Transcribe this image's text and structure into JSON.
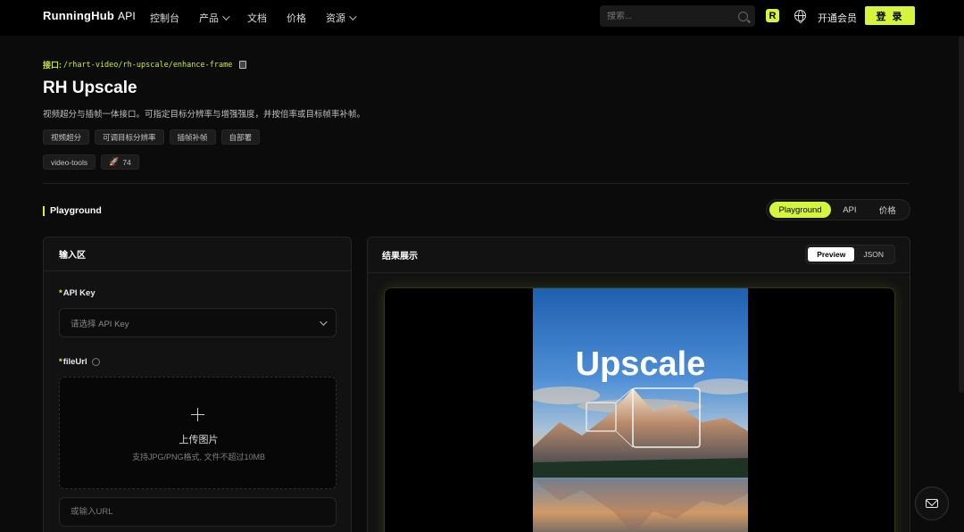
{
  "brand": {
    "name": "RunningHub",
    "suffix": "API"
  },
  "nav": {
    "items": [
      {
        "label": "控制台",
        "has_menu": false
      },
      {
        "label": "产品",
        "has_menu": true
      },
      {
        "label": "文档",
        "has_menu": false
      },
      {
        "label": "价格",
        "has_menu": false
      },
      {
        "label": "资源",
        "has_menu": true
      }
    ],
    "search_placeholder": "搜索...",
    "badge_letter": "R",
    "vip_label": "开通会员",
    "login_label": "登 录"
  },
  "endpoint": {
    "label": "接口:",
    "path": "/rhart-video/rh-upscale/enhance-frame"
  },
  "title": "RH Upscale",
  "description": "视频超分与插帧一体接口。可指定目标分辨率与增强强度，并按倍率或目标帧率补帧。",
  "tags": [
    "视频超分",
    "可调目标分辨率",
    "插帧补帧",
    "自部署"
  ],
  "tags2": {
    "category": "video-tools",
    "count": "74"
  },
  "playground": {
    "label": "Playground",
    "tabs": [
      "Playground",
      "API",
      "价格"
    ],
    "active_tab": "Playground"
  },
  "input_panel": {
    "title": "输入区",
    "api_key": {
      "label": "API Key",
      "placeholder": "请选择 API Key"
    },
    "file_url": {
      "label": "fileUrl",
      "upload_title": "上传图片",
      "upload_hint": "支持JPG/PNG格式, 文件不超过10MB",
      "url_placeholder": "或输入URL"
    }
  },
  "result_panel": {
    "title": "结果展示",
    "tabs": [
      "Preview",
      "JSON"
    ],
    "active_tab": "Preview",
    "poster_text": "Upscale"
  },
  "colors": {
    "accent": "#d4f53c",
    "background": "#0b0b0b"
  }
}
